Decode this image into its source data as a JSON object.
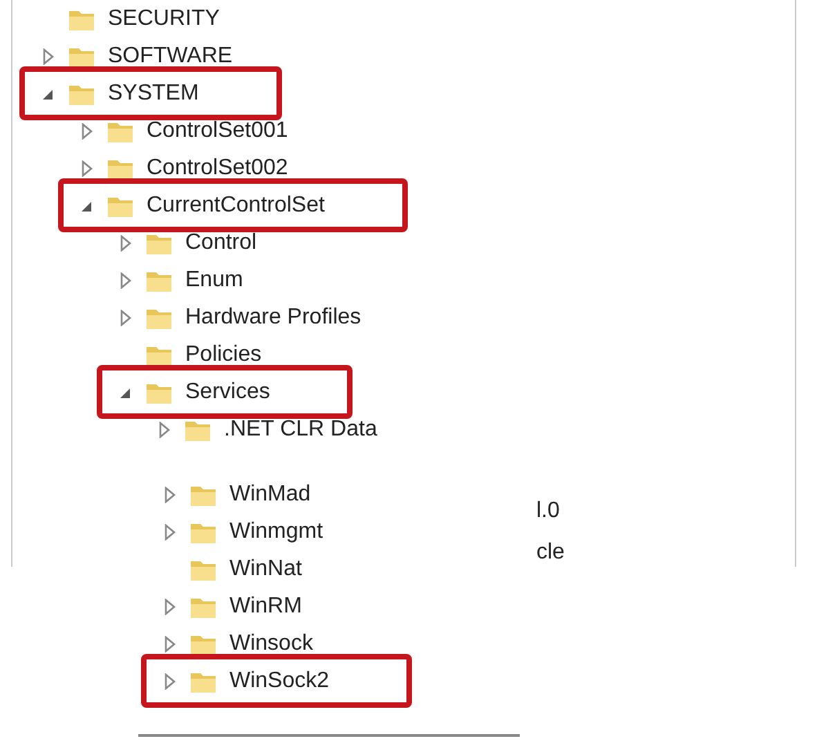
{
  "tree": [
    {
      "label": "SECURITY",
      "highlighted": false
    },
    {
      "label": "SOFTWARE",
      "expanded": false,
      "highlighted": false
    },
    {
      "label": "SYSTEM",
      "expanded": true,
      "highlighted": true,
      "children": [
        {
          "label": "ControlSet001",
          "expanded": false,
          "highlighted": false
        },
        {
          "label": "ControlSet002",
          "expanded": false,
          "highlighted": false
        },
        {
          "label": "CurrentControlSet",
          "expanded": true,
          "highlighted": true,
          "children": [
            {
              "label": "Control",
              "expanded": false,
              "highlighted": false
            },
            {
              "label": "Enum",
              "expanded": false,
              "highlighted": false
            },
            {
              "label": "Hardware Profiles",
              "expanded": false,
              "highlighted": false
            },
            {
              "label": "Policies",
              "highlighted": false
            },
            {
              "label": "Services",
              "expanded": true,
              "highlighted": true,
              "children": [
                {
                  "label": ".NET CLR Data",
                  "expanded": false,
                  "highlighted": false
                }
              ]
            }
          ]
        }
      ]
    }
  ],
  "overlay": {
    "items": [
      {
        "label": "WinMad",
        "expanded": false,
        "highlighted": false
      },
      {
        "label": "Winmgmt",
        "expanded": false,
        "highlighted": false
      },
      {
        "label": "WinNat",
        "highlighted": false
      },
      {
        "label": "WinRM",
        "expanded": false,
        "highlighted": false
      },
      {
        "label": "Winsock",
        "expanded": false,
        "highlighted": false
      },
      {
        "label": "WinSock2",
        "expanded": false,
        "highlighted": true
      }
    ]
  },
  "side_fragments": [
    "l.0",
    "cle"
  ]
}
